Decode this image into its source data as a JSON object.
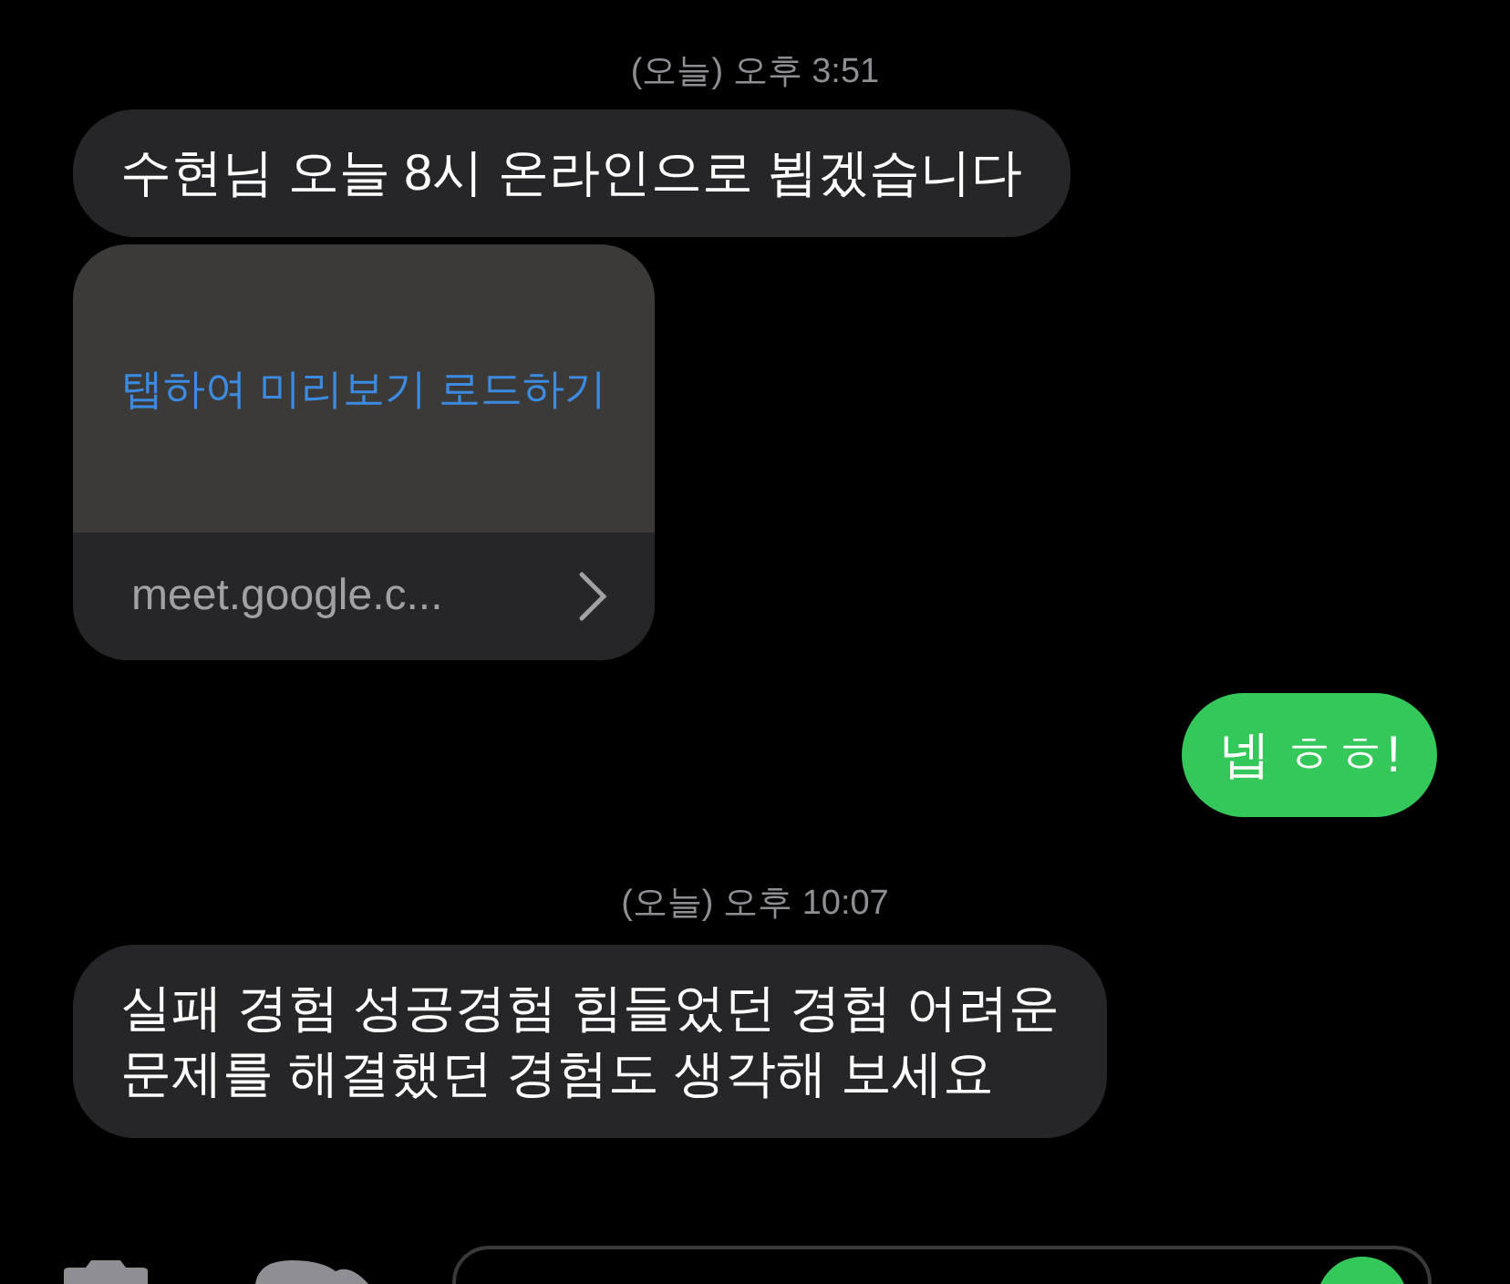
{
  "messages": [
    {
      "kind": "timestamp",
      "text": "(오늘) 오후 3:51"
    },
    {
      "kind": "received",
      "text": "수현님 오늘 8시 온라인으로 뵙겠습니다"
    },
    {
      "kind": "link_preview",
      "action": "탭하여 미리보기 로드하기",
      "url": "meet.google.c..."
    },
    {
      "kind": "sent",
      "text": "넵 ㅎㅎ!"
    },
    {
      "kind": "timestamp",
      "text": "(오늘) 오후 10:07"
    },
    {
      "kind": "received",
      "text": "실패 경험 성공경험 힘들었던 경험 어려운\n문제를 해결했던 경험도 생각해 보세요"
    }
  ]
}
